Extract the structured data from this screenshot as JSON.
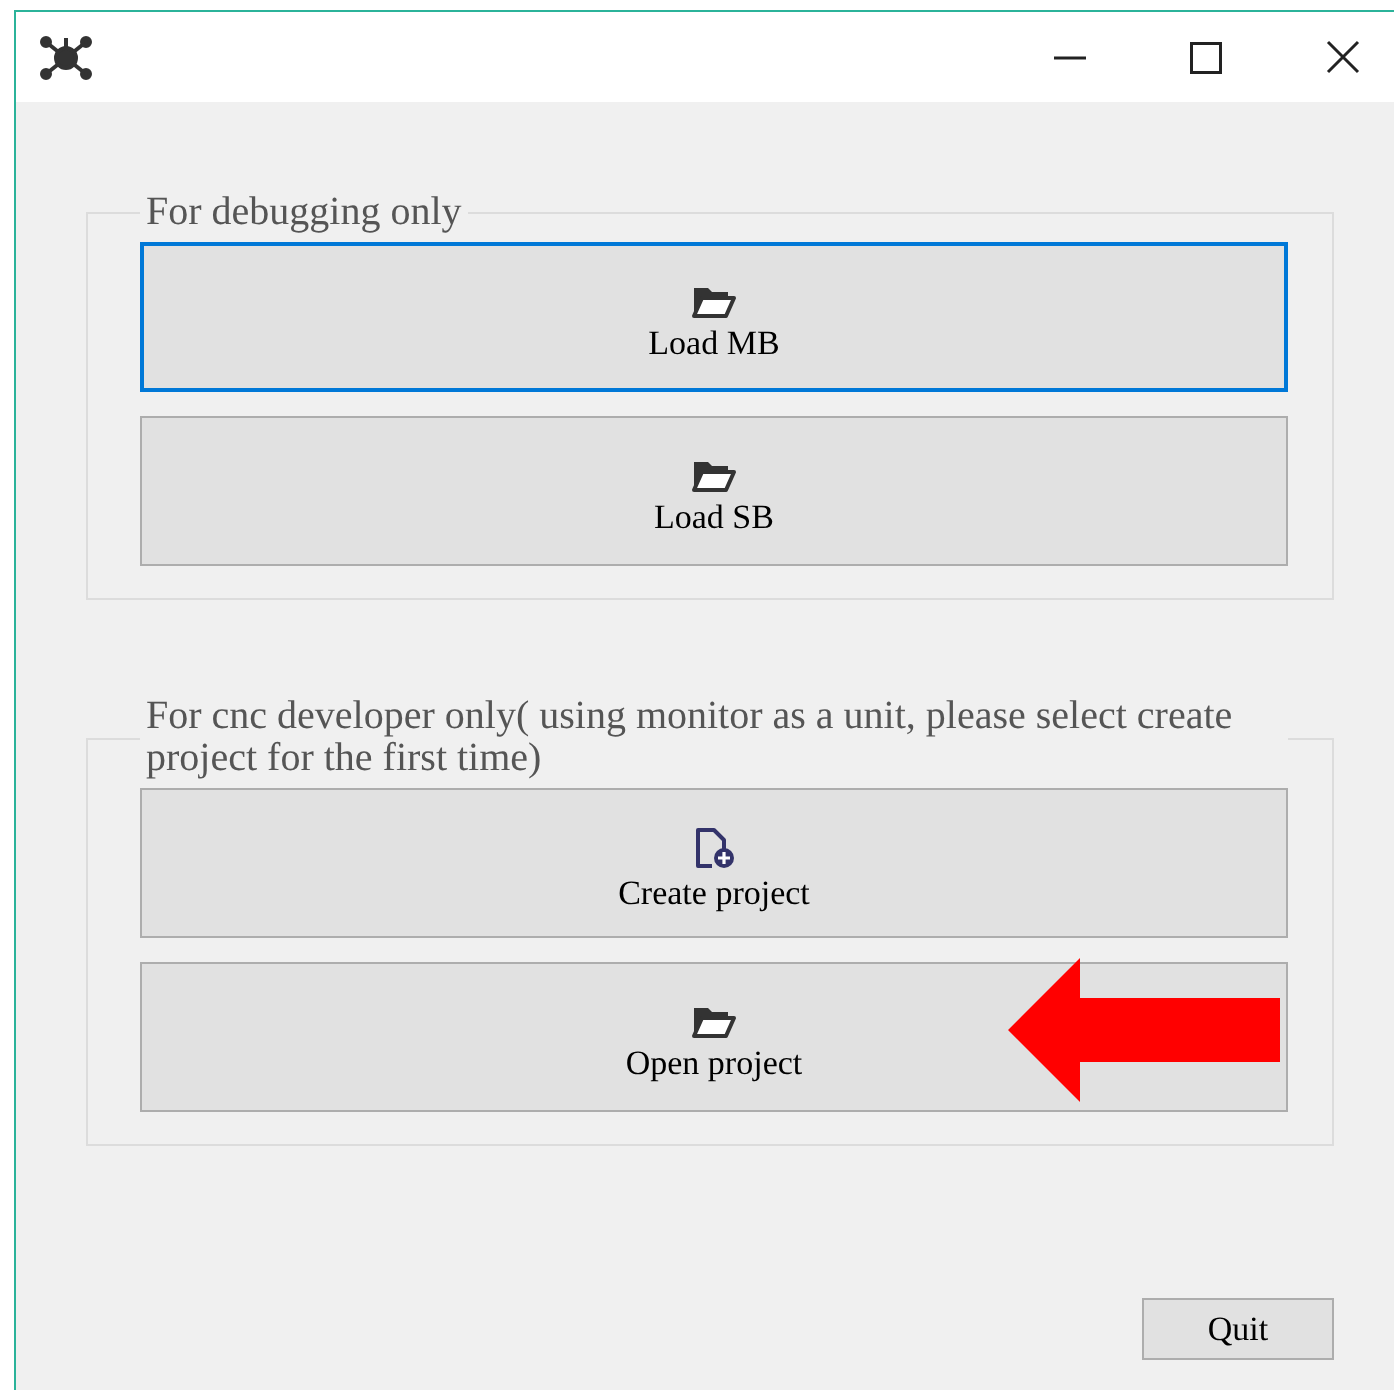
{
  "groups": [
    {
      "label": "For debugging only",
      "buttons": [
        {
          "label": "Load MB",
          "kind": "folder",
          "focused": true
        },
        {
          "label": "Load SB",
          "kind": "folder",
          "focused": false
        }
      ]
    },
    {
      "label": "For cnc developer only( using monitor as a unit, please select create project for the first time)",
      "buttons": [
        {
          "label": "Create project",
          "kind": "new-file",
          "focused": false
        },
        {
          "label": "Open project",
          "kind": "folder",
          "focused": false,
          "annotated": true
        }
      ]
    }
  ],
  "quit": {
    "label": "Quit"
  }
}
